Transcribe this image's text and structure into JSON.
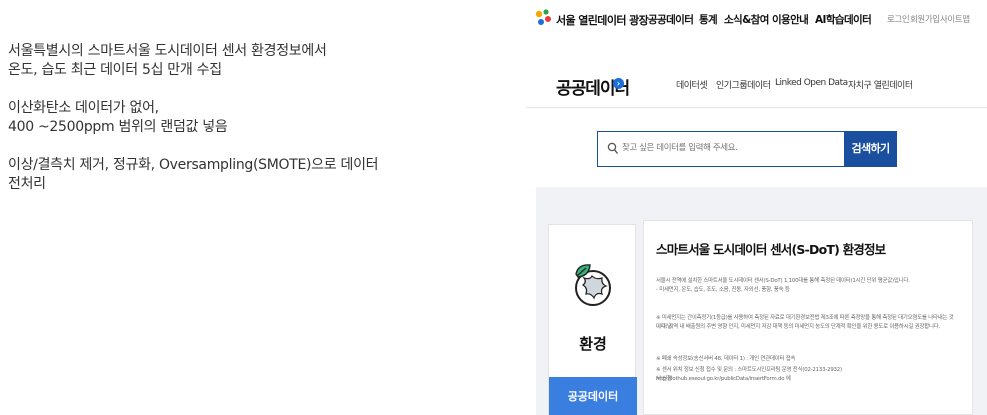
{
  "notes": {
    "line1": "서울특별시의 스마트서울 도시데이터 센서 환경정보에서",
    "line2": "온도, 습도 최근 데이터 5십 만개 수집",
    "line3": "이산화탄소 데이터가 없어,",
    "line4": "400 ~2500ppm 범위의 랜덤값 넣음",
    "line5": "이상/결측치 제거, 정규화, Oversampling(SMOTE)으로 데이터",
    "line6": "전처리"
  },
  "site": {
    "brand": "서울 열린데이터 광장",
    "nav": [
      "공공데이터",
      "통계",
      "소식&참여",
      "이용안내",
      "AI학습데이터"
    ],
    "util": [
      "로그인",
      "회원가입",
      "사이트맵"
    ],
    "section_title": "공공데이터",
    "section_icon": "›",
    "tabs": [
      "데이터셋",
      "인기그룹데이터",
      "Linked Open Data",
      "자치구 열린데이터"
    ],
    "search_placeholder": "찾고 싶은 데이터를 입력해 주세요.",
    "search_button": "검색하기",
    "category_label": "환경",
    "category_badge": "공공데이터",
    "dataset_title": "스마트서울 도시데이터 센서(S-DoT) 환경정보",
    "desc1": "서울시 전역에 설치한 스마트서울 도시데이터 센서(S-DoT) 1,100대를 통해 측정된 데이터(1시간 단위 평균값)입니다.",
    "desc2": "- 미세먼지, 온도, 습도, 조도, 소음, 진동, 자외선, 풍향, 풍속 등",
    "desc3": "※ 미세먼지는 간이측정기(1등급)를 사용하여 측정된 자료로 대기환경보전법 제3조에 따른 측정망을 통해 측정된 대기오염도를 나타내는 것이 아닙",
    "desc4": "니다. 지역 내 배출원의 주변 영향 인지, 미세먼지 저감 대책 등의 미세먼지 농도의 단계적 확인을 위한 용도로 이용하시길 권장합니다.",
    "desc5": "※ 폐쇄 속성정보(송신서버 48, 데이터 1) : 개인 연관데이터 접속",
    "desc6": "※ 센서 위치 정보 신청 접수 및 문의 : 스마트도시인프라팀 운영 전식(02-2133-2932) http://iothub.eseoul.go.kr/publicData/insertForm.do 에",
    "desc7": "서 신청"
  },
  "colors": {
    "brand_blue": "#1a4fa0",
    "badge_blue": "#3a7ee0",
    "content_bg": "#f0f2f5"
  }
}
